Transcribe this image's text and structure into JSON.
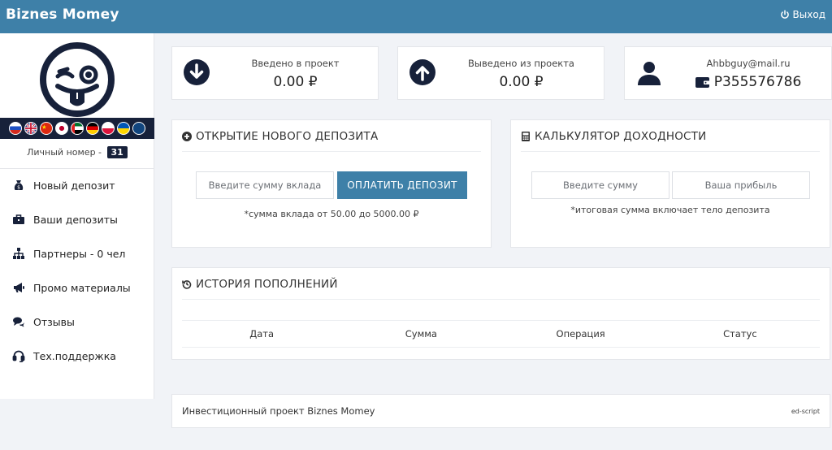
{
  "header": {
    "brand": "Biznes Momey",
    "logout_label": "Выход"
  },
  "sidebar": {
    "personal_number_label": "Личный номер -",
    "personal_number": "31",
    "flags": [
      "ru",
      "gb",
      "cn",
      "jp",
      "ae",
      "de",
      "pl",
      "ua",
      "cz"
    ],
    "menu": [
      {
        "label": "Новый депозит",
        "icon": "money-bag-icon"
      },
      {
        "label": "Ваши депозиты",
        "icon": "briefcase-icon"
      },
      {
        "label": "Партнеры - 0 чел",
        "icon": "sitemap-icon"
      },
      {
        "label": "Промо материалы",
        "icon": "megaphone-icon"
      },
      {
        "label": "Отзывы",
        "icon": "comments-icon"
      },
      {
        "label": "Тех.поддержка",
        "icon": "headset-icon"
      }
    ]
  },
  "stats": {
    "deposited": {
      "label": "Введено в проект",
      "value": "0.00 ₽"
    },
    "withdrawn": {
      "label": "Выведено из проекта",
      "value": "0.00 ₽"
    },
    "user": {
      "email": "Ahbbguy@mail.ru",
      "wallet": "P355576786"
    }
  },
  "deposit": {
    "title": "ОТКРЫТИЕ НОВОГО ДЕПОЗИТА",
    "amount_placeholder": "Введите сумму вклада",
    "pay_button": "ОПЛАТИТЬ ДЕПОЗИТ",
    "note": "*сумма вклада от 50.00 до 5000.00 ₽"
  },
  "calculator": {
    "title": "КАЛЬКУЛЯТОР ДОХОДНОСТИ",
    "amount_placeholder": "Введите сумму",
    "profit_placeholder": "Ваша прибыль",
    "note": "*итоговая сумма включает тело депозита"
  },
  "history": {
    "title": "ИСТОРИЯ ПОПОЛНЕНИЙ",
    "columns": [
      "Дата",
      "Сумма",
      "Операция",
      "Статус"
    ]
  },
  "footer": {
    "text": "Инвестиционный проект Biznes Momey",
    "credit": "ed-script"
  },
  "colors": {
    "accent": "#3e80a8",
    "dark": "#17213a"
  }
}
